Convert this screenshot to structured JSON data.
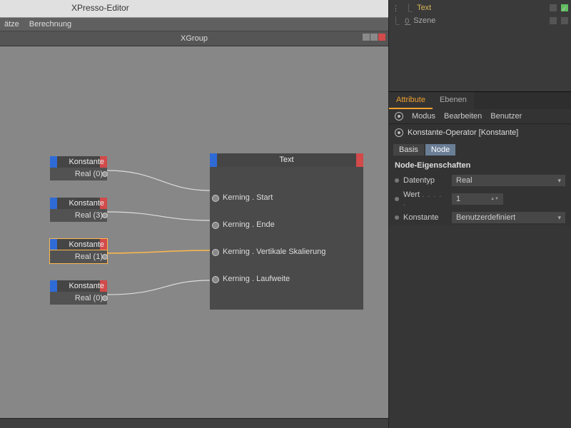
{
  "window": {
    "title": "XPresso-Editor"
  },
  "menubar": {
    "items": [
      "ätze",
      "Berechnung"
    ]
  },
  "xgroup": {
    "title": "XGroup"
  },
  "nodes": {
    "const": [
      {
        "label": "Konstante",
        "value": "Real (0)"
      },
      {
        "label": "Konstante",
        "value": "Real (3)"
      },
      {
        "label": "Konstante",
        "value": "Real (1)"
      },
      {
        "label": "Konstante",
        "value": "Real (0)"
      }
    ],
    "text": {
      "title": "Text",
      "inputs": [
        "Kerning . Start",
        "Kerning . Ende",
        "Kerning . Vertikale Skalierung",
        "Kerning . Laufweite"
      ]
    }
  },
  "scene": {
    "rows": [
      {
        "label": "Text",
        "hl": true
      },
      {
        "label": "Szene",
        "hl": false
      }
    ]
  },
  "attr": {
    "tabs": {
      "attribute": "Attribute",
      "ebenen": "Ebenen"
    },
    "menubar": [
      "Modus",
      "Bearbeiten",
      "Benutzer"
    ],
    "title": "Konstante-Operator [Konstante]",
    "subTabs": {
      "basis": "Basis",
      "node": "Node"
    },
    "section": "Node-Eigenschaften",
    "props": {
      "datentyp": {
        "label": "Datentyp",
        "value": "Real"
      },
      "wert": {
        "label": "Wert",
        "value": "1"
      },
      "konstante": {
        "label": "Konstante",
        "value": "Benutzerdefiniert"
      }
    }
  }
}
